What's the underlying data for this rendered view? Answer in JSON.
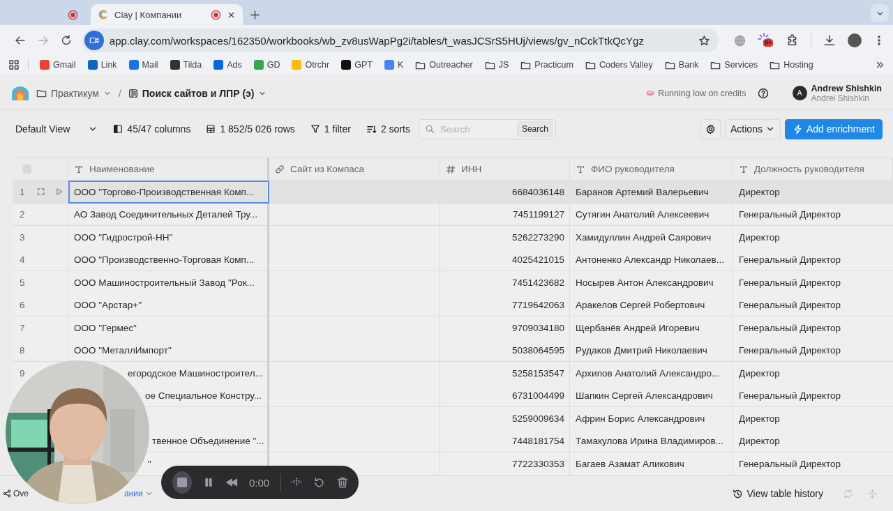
{
  "browser": {
    "tabs": [
      {
        "selected": false
      },
      {
        "title": "Clay | Компании",
        "selected": true
      }
    ],
    "url": "app.clay.com/workspaces/162350/workbooks/wb_zv8usWapPg2i/tables/t_wasJCSrS5HUj/views/gv_nCckTtkQcYgz",
    "extension_badge": "9+",
    "bookmarks": [
      {
        "label": "Gmail",
        "kind": "site",
        "color": "#ea4335"
      },
      {
        "label": "Link",
        "kind": "site",
        "color": "#0a66c2"
      },
      {
        "label": "Mail",
        "kind": "site",
        "color": "#1a73e8"
      },
      {
        "label": "Tilda",
        "kind": "site",
        "color": "#333333"
      },
      {
        "label": "Ads",
        "kind": "site",
        "color": "#0668e1"
      },
      {
        "label": "GD",
        "kind": "site",
        "color": "#34a853"
      },
      {
        "label": "Otrchr",
        "kind": "site",
        "color": "#fbbc04"
      },
      {
        "label": "GPT",
        "kind": "site",
        "color": "#111111"
      },
      {
        "label": "K",
        "kind": "site",
        "color": "#4285f4"
      },
      {
        "label": "Outreacher",
        "kind": "folder"
      },
      {
        "label": "JS",
        "kind": "folder"
      },
      {
        "label": "Practicum",
        "kind": "folder"
      },
      {
        "label": "Coders Valley",
        "kind": "folder"
      },
      {
        "label": "Bank",
        "kind": "folder"
      },
      {
        "label": "Services",
        "kind": "folder"
      },
      {
        "label": "Hosting",
        "kind": "folder"
      }
    ]
  },
  "app_header": {
    "breadcrumb": [
      {
        "label": "Практикум",
        "kind": "folder"
      },
      {
        "label": "Поиск сайтов и ЛПР (э)",
        "kind": "table"
      }
    ],
    "separator": "/",
    "credits_notice": "Running low on credits",
    "user": {
      "initial": "A",
      "name": "Andrew Shishkin",
      "account": "Andrei Shishkin"
    }
  },
  "toolbar": {
    "view": "Default View",
    "columns": "45/47 columns",
    "rows": "1 852/5 026 rows",
    "filter": "1 filter",
    "sorts": "2 sorts",
    "search": {
      "placeholder": "Search",
      "button": "Search"
    },
    "actions": "Actions",
    "add_button": "Add enrichment"
  },
  "table": {
    "select_all": {
      "checked": false
    },
    "columns": [
      {
        "label": "Наименование",
        "kind": "text"
      },
      {
        "label": "Сайт из Компаса",
        "kind": "link"
      },
      {
        "label": "ИНН",
        "kind": "number"
      },
      {
        "label": "ФИО руководителя",
        "kind": "text"
      },
      {
        "label": "Должность руководителя",
        "kind": "text"
      }
    ],
    "rows": [
      {
        "number": "1",
        "selected": true,
        "name": "ООО \"Торгово-Производственная Комп...",
        "inn": "6684036148",
        "director": "Баранов Артемий Валерьевич",
        "position": "Директор"
      },
      {
        "number": "2",
        "selected": false,
        "name": "АО Завод Соединительных Деталей Тру...",
        "inn": "7451199127",
        "director": "Сутягин Анатолий Алексеевич",
        "position": "Генеральный Директор"
      },
      {
        "number": "3",
        "selected": false,
        "name": "ООО \"Гидрострой-НН\"",
        "inn": "5262273290",
        "director": "Хамидуллин Андрей Саярович",
        "position": "Директор"
      },
      {
        "number": "4",
        "selected": false,
        "name": "ООО \"Производственно-Торговая Комп...",
        "inn": "4025421015",
        "director": "Антоненко Александр Николаев...",
        "position": "Генеральный Директор"
      },
      {
        "number": "5",
        "selected": false,
        "name": "ООО Машиностроительный Завод \"Рок...",
        "inn": "7451423682",
        "director": "Носырев Антон Александрович",
        "position": "Генеральный Директор"
      },
      {
        "number": "6",
        "selected": false,
        "name": "ООО \"Арстар+\"",
        "inn": "7719642063",
        "director": "Аракелов Сергей Робертович",
        "position": "Генеральный Директор"
      },
      {
        "number": "7",
        "selected": false,
        "name": "ООО \"Гермес\"",
        "inn": "9709034180",
        "director": "Щербанёв Андрей Игоревич",
        "position": "Генеральный Директор"
      },
      {
        "number": "8",
        "selected": false,
        "name": "ООО \"МеталлИмпорт\"",
        "inn": "5038064595",
        "director": "Рудаков Дмитрий Николаевич",
        "position": "Генеральный Директор"
      },
      {
        "number": "9",
        "selected": false,
        "name": "егородское Машиностроител...",
        "inn": "5258153547",
        "director": "Архипов Анатолий Александро...",
        "position": "Директор"
      },
      {
        "selected": false,
        "name": "ое Специальное Констру...",
        "inn": "6731004499",
        "director": "Шапкин Сергей Александрович",
        "position": "Генеральный Директор"
      },
      {
        "selected": false,
        "inn": "5259009634",
        "director": "Африн Борис Александрович",
        "position": "Директор"
      },
      {
        "selected": false,
        "name": "твенное Объединение \"...",
        "inn": "7448181754",
        "director": "Тамакулова Ирина Владимиров...",
        "position": "Директор"
      },
      {
        "selected": false,
        "name": "\"",
        "inn": "7722330353",
        "director": "Багаев Азамат Аликович",
        "position": "Генеральный Директор"
      }
    ]
  },
  "bottom_bar": {
    "tabs": [
      {
        "label": "Ove",
        "kind": "overview",
        "selected": false
      },
      {
        "label": "ании",
        "kind": "table",
        "selected": true
      }
    ],
    "history": "View table history"
  },
  "recorder": {
    "time": "0:00"
  }
}
